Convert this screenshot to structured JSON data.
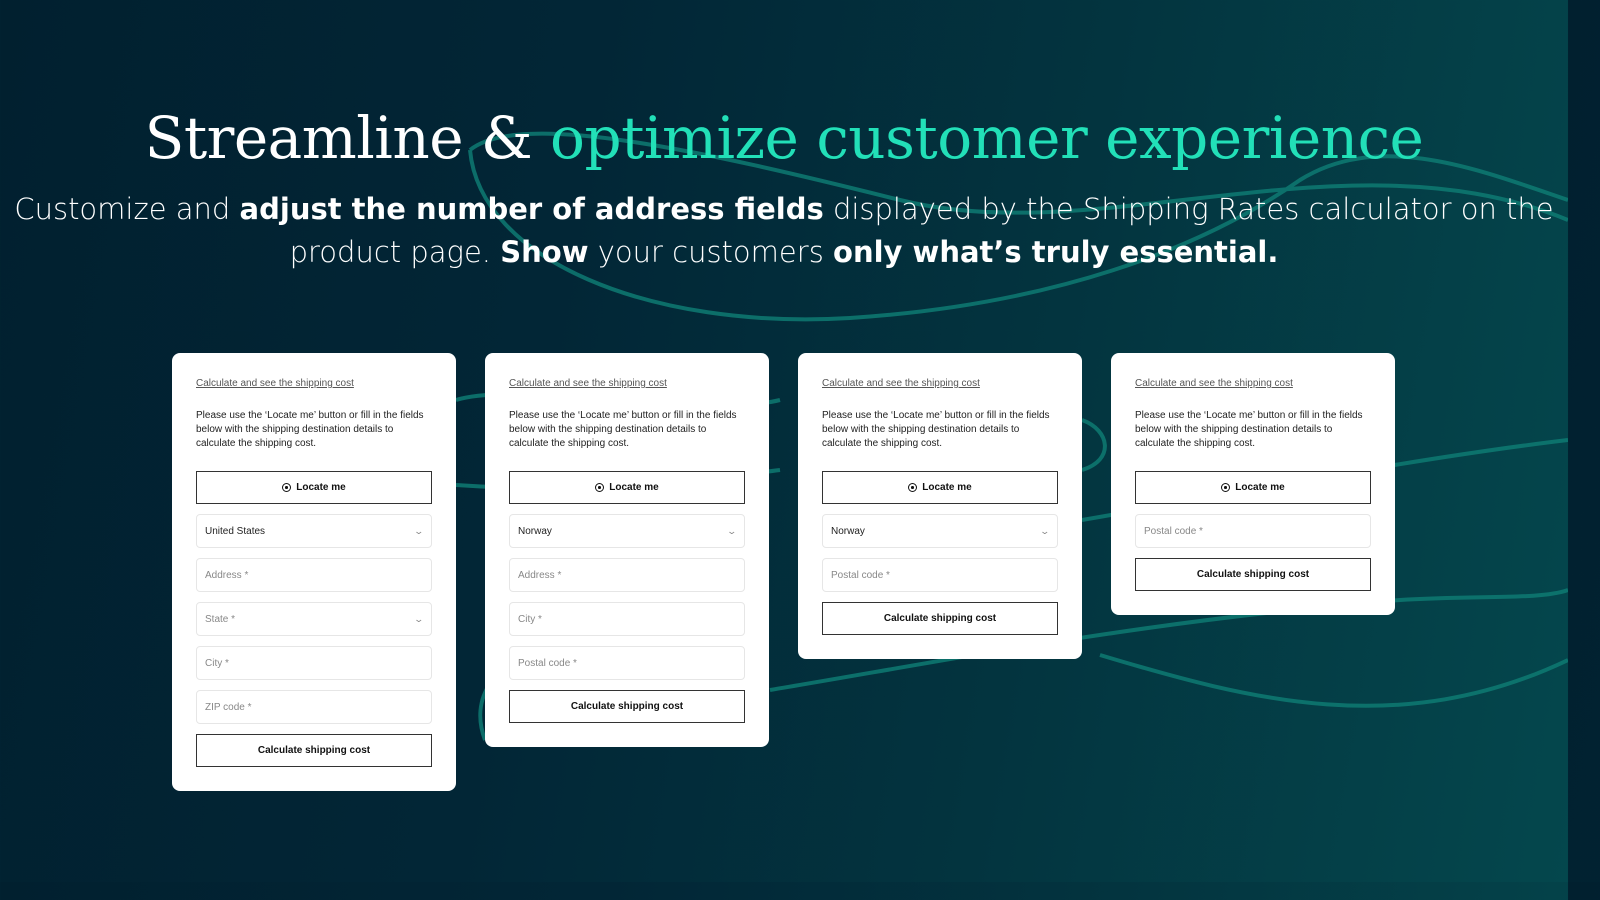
{
  "hero": {
    "title_plain": "Streamline & ",
    "title_accent": "optimize customer experience",
    "subtitle": {
      "p1": "Customize and ",
      "b1": "adjust the number of address fields",
      "p2": " displayed by the Shipping Rates calculator on the product page. ",
      "b2": "Show",
      "p3": " your customers ",
      "b3": "only what’s truly essential."
    }
  },
  "colors": {
    "accent": "#22e0b8",
    "background_dark": "#01202f",
    "background_teal": "#04474d",
    "curve": "#0e7a72"
  },
  "cards": [
    {
      "link": "Calculate and see the shipping cost",
      "description": "Please use the ‘Locate me’ button or fill in the fields below with the shipping destination details to calculate the shipping cost.",
      "locate_label": "Locate me",
      "country": "United States",
      "fields": [
        "Address *",
        "State *",
        "City *",
        "ZIP code *"
      ],
      "submit_label": "Calculate shipping cost"
    },
    {
      "link": "Calculate and see the shipping cost",
      "description": "Please use the ‘Locate me’ button or fill in the fields below with the shipping destination details to calculate the shipping cost.",
      "locate_label": "Locate me",
      "country": "Norway",
      "fields": [
        "Address *",
        "City *",
        "Postal code *"
      ],
      "submit_label": "Calculate shipping cost"
    },
    {
      "link": "Calculate and see the shipping cost",
      "description": "Please use the ‘Locate me’ button or fill in the fields below with the shipping destination details to calculate the shipping cost.",
      "locate_label": "Locate me",
      "country": "Norway",
      "fields": [
        "Postal code *"
      ],
      "submit_label": "Calculate shipping cost"
    },
    {
      "link": "Calculate and see the shipping cost",
      "description": "Please use the ‘Locate me’ button or fill in the fields below with the shipping destination details to calculate the shipping cost.",
      "locate_label": "Locate me",
      "fields": [
        "Postal code *"
      ],
      "submit_label": "Calculate shipping cost"
    }
  ]
}
